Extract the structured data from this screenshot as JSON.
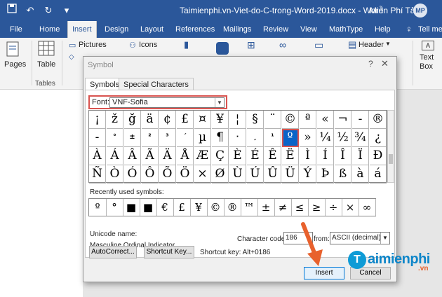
{
  "titlebar": {
    "document_title": "Taimienphi.vn-Viet-do-C-trong-Word-2019.docx  -  Word",
    "user_name": "Miễn Phí Tải",
    "avatar_initials": "MP",
    "qat_icons": [
      "save-icon",
      "undo-icon",
      "redo-icon",
      "customize-icon"
    ]
  },
  "ribbon_tabs": [
    "File",
    "Home",
    "Insert",
    "Design",
    "Layout",
    "References",
    "Mailings",
    "Review",
    "View",
    "MathType",
    "Help",
    "Tell me"
  ],
  "active_tab": "Insert",
  "ribbon": {
    "pages_label": "Pages",
    "table_label": "Table",
    "tables_group": "Tables",
    "pictures_label": "Pictures",
    "icons_label": "Icons",
    "header_label": "Header",
    "text_box_label": "Text Box"
  },
  "dialog": {
    "title": "Symbol",
    "help": "?",
    "close": "✕",
    "tabs": [
      "Symbols",
      "Special Characters"
    ],
    "font_label": "Font:",
    "font_value": "VNF-Sofia",
    "symbol_grid": [
      [
        "¡",
        "ž",
        "ğ",
        "ä",
        "¢",
        "£",
        "¤",
        "¥",
        "¦",
        "§",
        "¨",
        "©",
        "ª",
        "«",
        "¬",
        "-",
        "®"
      ],
      [
        "-",
        "°",
        "±",
        "²",
        "³",
        "´",
        "µ",
        "¶",
        "·",
        "¸",
        "¹",
        "º",
        "»",
        "¼",
        "½",
        "¾",
        "¿"
      ],
      [
        "À",
        "Á",
        "Â",
        "Ã",
        "Ä",
        "Å",
        "Æ",
        "Ç",
        "È",
        "É",
        "Ê",
        "Ë",
        "Ì",
        "Í",
        "Î",
        "Ï",
        "Ð"
      ],
      [
        "Ñ",
        "Ò",
        "Ó",
        "Ô",
        "Õ",
        "Ö",
        "×",
        "Ø",
        "Ù",
        "Ú",
        "Û",
        "Ü",
        "Ý",
        "Þ",
        "ß",
        "à",
        "á"
      ]
    ],
    "selected_symbol": "º",
    "recent_label": "Recently used symbols:",
    "recent_symbols": [
      "º",
      "°",
      "■",
      "■",
      "€",
      "£",
      "¥",
      "©",
      "®",
      "™",
      "±",
      "≠",
      "≤",
      "≥",
      "÷",
      "×",
      "∞"
    ],
    "unicode_name_label": "Unicode name:",
    "unicode_name": "Masculine Ordinal Indicator",
    "char_code_label": "Character code:",
    "char_code": "186",
    "from_label": "from:",
    "from_value": "ASCII (decimal)",
    "autocorrect_btn": "AutoCorrect...",
    "shortcut_btn": "Shortcut Key...",
    "shortcut_text": "Shortcut key: Alt+0186",
    "insert_btn": "Insert",
    "cancel_btn": "Cancel"
  },
  "watermark": {
    "logo_letter": "T",
    "brand": "aimienphi",
    "suffix": ".vn"
  },
  "colors": {
    "word_blue": "#2b579a",
    "highlight_red": "#d9534f",
    "selection_blue": "#0a64c8",
    "arrow_orange": "#e8612d"
  }
}
